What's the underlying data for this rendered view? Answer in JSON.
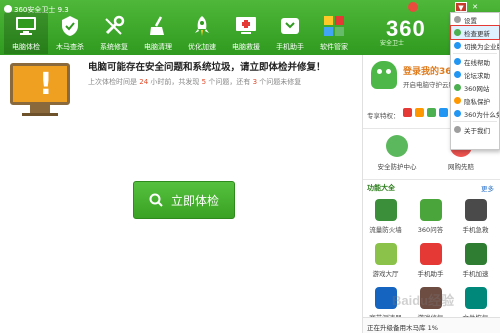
{
  "window": {
    "title": "360安全卫士 9.3"
  },
  "tools": [
    {
      "label": "电脑体检",
      "icon": "computer-check-icon"
    },
    {
      "label": "木马查杀",
      "icon": "trojan-scan-icon"
    },
    {
      "label": "系统修复",
      "icon": "system-repair-icon"
    },
    {
      "label": "电脑清理",
      "icon": "cleanup-icon"
    },
    {
      "label": "优化加速",
      "icon": "speedup-icon"
    },
    {
      "label": "电脑救援",
      "icon": "rescue-icon"
    },
    {
      "label": "手机助手",
      "icon": "phone-assistant-icon"
    },
    {
      "label": "软件管家",
      "icon": "software-manager-icon"
    }
  ],
  "brand": {
    "name": "360",
    "tagline": "安全卫士"
  },
  "window_controls": {
    "minimize": "—",
    "close": "✕",
    "menu": "▼"
  },
  "checkup": {
    "warning": "电脑可能存在安全问题和系统垃圾，请立即体检并修复！",
    "sub_prefix": "上次体检时间是",
    "hours": "24",
    "sub_mid1": "小时前，共发现",
    "issues": "5",
    "sub_mid2": "个问题，还有",
    "remaining": "3",
    "sub_suffix": "个问题未修复",
    "button_label": "立即体检"
  },
  "account": {
    "login_title": "登录我的360",
    "login_sub": "开启电脑守护云服务，享受...",
    "member_label": "专享特权："
  },
  "quick_actions": [
    {
      "label": "安全防护中心"
    },
    {
      "label": "网购先赔"
    }
  ],
  "tools_section": {
    "title": "功能大全",
    "more": "更多"
  },
  "apps": [
    {
      "label": "流量防火墙",
      "color": "#3b8f3a"
    },
    {
      "label": "360问答",
      "color": "#4aa63a"
    },
    {
      "label": "手机急救",
      "color": "#4a4a4a"
    },
    {
      "label": "游戏大厅",
      "color": "#8bc34a"
    },
    {
      "label": "手机助手",
      "color": "#e53935"
    },
    {
      "label": "手机加速",
      "color": "#2e7d32"
    },
    {
      "label": "宽带测速器",
      "color": "#1565c0"
    },
    {
      "label": "游戏修复",
      "color": "#6d4c41"
    },
    {
      "label": "文件恢复",
      "color": "#00897b"
    }
  ],
  "status": {
    "text": "正在升级备用木马库 1%"
  },
  "settings_menu": {
    "items": [
      {
        "label": "设置",
        "color": "#9e9e9e"
      },
      {
        "label": "检查更新",
        "color": "#4caf50",
        "highlight": true
      },
      {
        "label": "切换为企业版",
        "color": "#2196f3"
      },
      {
        "label": "在线帮助",
        "color": "#2196f3"
      },
      {
        "label": "论坛求助",
        "color": "#2196f3"
      },
      {
        "label": "360网站",
        "color": "#4caf50"
      },
      {
        "label": "隐私保护",
        "color": "#ff9800"
      },
      {
        "label": "360为什么免费",
        "color": "#2196f3"
      },
      {
        "label": "关于我们",
        "color": "#9e9e9e"
      }
    ]
  },
  "watermark": "Baidu经验",
  "colors": {
    "header_green": "#3aa224",
    "accent_red": "#e04a2a",
    "button_green": "#55c03e"
  }
}
